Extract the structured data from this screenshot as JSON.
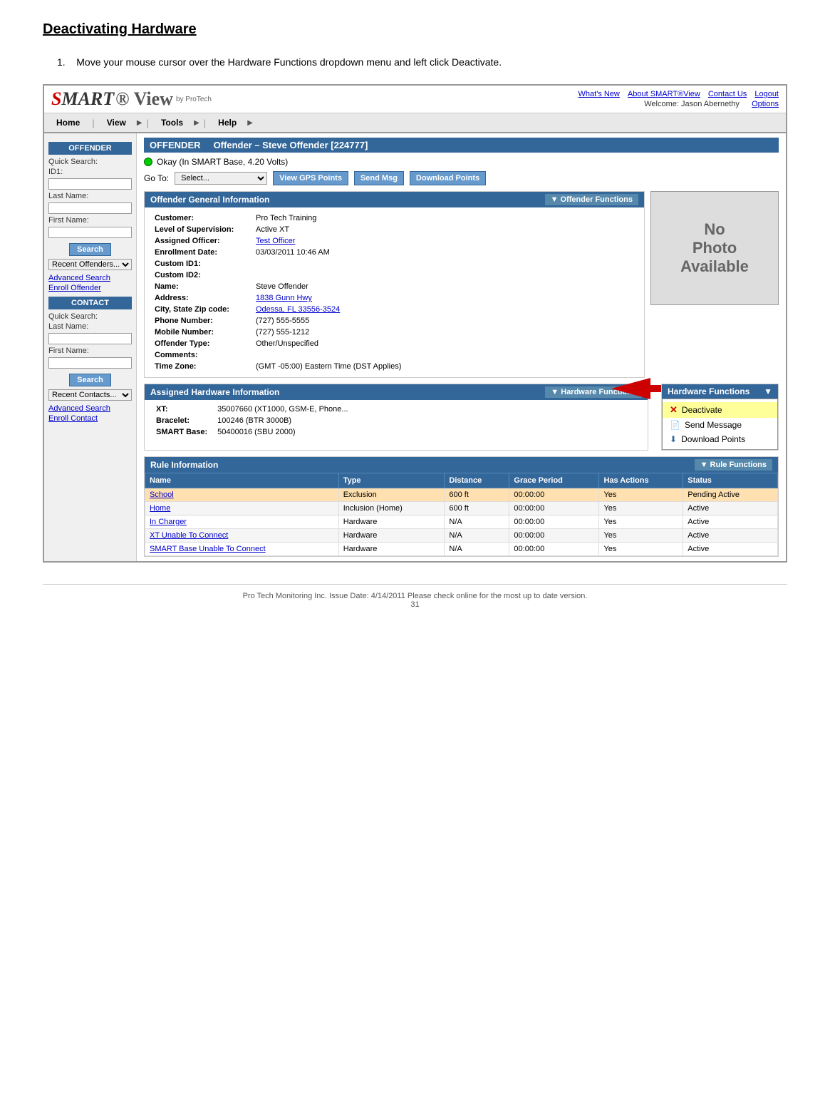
{
  "page": {
    "title": "Deactivating Hardware",
    "instruction_number": "1.",
    "instruction_text": "Move your mouse cursor over the Hardware Functions dropdown menu and left click Deactivate."
  },
  "app": {
    "logo_smart": "SMART",
    "logo_view": "® View",
    "logo_byprotech": "by ProTech",
    "top_links": {
      "whats_new": "What's New",
      "about": "About SMART®View",
      "contact": "Contact Us",
      "logout": "Logout"
    },
    "welcome_text": "Welcome: Jason Abernethy",
    "options_link": "Options"
  },
  "nav": {
    "home": "Home",
    "view": "View",
    "tools": "Tools",
    "help": "Help"
  },
  "offender_header": "OFFENDER",
  "offender_title": "Offender – Steve Offender [224777]",
  "status": {
    "text": "Okay (In SMART Base, 4.20 Volts)"
  },
  "goto": {
    "label": "Go To:",
    "placeholder": "Select...",
    "btn_gps": "View GPS Points",
    "btn_msg": "Send Msg",
    "btn_download": "Download Points"
  },
  "sidebar": {
    "offender_section": "OFFENDER",
    "quick_search_label": "Quick Search:",
    "id1_label": "ID1:",
    "last_name_label": "Last Name:",
    "first_name_label": "First Name:",
    "search_button": "Search",
    "recent_offenders": "Recent Offenders...",
    "advanced_search": "Advanced Search",
    "enroll_offender": "Enroll Offender",
    "contact_section": "CONTACT",
    "quick_search_label2": "Quick Search:",
    "last_name_label2": "Last Name:",
    "first_name_label2": "First Name:",
    "search_button2": "Search",
    "recent_contacts": "Recent Contacts...",
    "advanced_search2": "Advanced Search",
    "enroll_contact": "Enroll Contact"
  },
  "offender_info": {
    "section_title": "Offender General Information",
    "offender_functions_btn": "Offender Functions",
    "fields": [
      {
        "label": "Customer:",
        "value": "Pro Tech Training"
      },
      {
        "label": "Level of Supervision:",
        "value": "Active XT"
      },
      {
        "label": "Assigned Officer:",
        "value": "Test Officer",
        "link": true
      },
      {
        "label": "Enrollment Date:",
        "value": "03/03/2011 10:46 AM"
      },
      {
        "label": "Custom ID1:",
        "value": ""
      },
      {
        "label": "Custom ID2:",
        "value": ""
      },
      {
        "label": "Name:",
        "value": "Steve Offender"
      },
      {
        "label": "Address:",
        "value": "1838 Gunn Hwy",
        "link": true
      },
      {
        "label": "City, State Zip code:",
        "value": "Odessa, FL 33556-3524",
        "link": true
      },
      {
        "label": "Phone Number:",
        "value": "(727) 555-5555"
      },
      {
        "label": "Mobile Number:",
        "value": "(727) 555-1212"
      },
      {
        "label": "Offender Type:",
        "value": "Other/Unspecified"
      },
      {
        "label": "Comments:",
        "value": ""
      },
      {
        "label": "Time Zone:",
        "value": "(GMT -05:00) Eastern Time (DST Applies)"
      }
    ]
  },
  "photo": {
    "text": "No\nPhoto\nAvailable"
  },
  "hardware_functions": {
    "title": "Hardware Functions",
    "items": [
      {
        "icon": "X",
        "label": "Deactivate",
        "highlighted": true
      },
      {
        "icon": "msg",
        "label": "Send Message"
      },
      {
        "icon": "dl",
        "label": "Download Points"
      }
    ]
  },
  "assigned_hardware": {
    "title": "Assigned Hardware Information",
    "fields": [
      {
        "label": "XT:",
        "value": "35007660 (XT1000, GSM-E, Phone...)"
      },
      {
        "label": "Bracelet:",
        "value": "100246 (BTR 3000B)"
      },
      {
        "label": "SMART Base:",
        "value": "50400016 (SBU 2000)"
      }
    ],
    "hw_functions_title": "Hardware Functions"
  },
  "rule_info": {
    "title": "Rule Information",
    "functions_btn": "Rule Functions",
    "columns": [
      "Name",
      "Type",
      "Distance",
      "Grace Period",
      "Has Actions",
      "Status"
    ],
    "rows": [
      {
        "name": "School",
        "type": "Exclusion",
        "distance": "600 ft",
        "grace": "00:00:00",
        "has_actions": "Yes",
        "status": "Pending Active",
        "highlight": true
      },
      {
        "name": "Home",
        "type": "Inclusion (Home)",
        "distance": "600 ft",
        "grace": "00:00:00",
        "has_actions": "Yes",
        "status": "Active"
      },
      {
        "name": "In Charger",
        "type": "Hardware",
        "distance": "N/A",
        "grace": "00:00:00",
        "has_actions": "Yes",
        "status": "Active"
      },
      {
        "name": "XT Unable To Connect",
        "type": "Hardware",
        "distance": "N/A",
        "grace": "00:00:00",
        "has_actions": "Yes",
        "status": "Active"
      },
      {
        "name": "SMART Base Unable To Connect",
        "type": "Hardware",
        "distance": "N/A",
        "grace": "00:00:00",
        "has_actions": "Yes",
        "status": "Active"
      }
    ]
  },
  "footer": {
    "text": "Pro Tech Monitoring Inc. Issue Date: 4/14/2011 Please check online for the most up to date version.",
    "page_number": "31"
  }
}
